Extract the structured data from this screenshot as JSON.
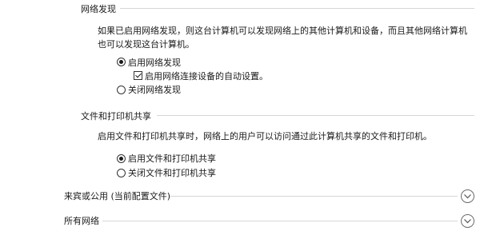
{
  "network_discovery": {
    "title": "网络发现",
    "description": "如果已启用网络发现，则这台计算机可以发现网络上的其他计算机和设备，而且其他网络计算机也可以发现这台计算机。",
    "options": {
      "enable": "启用网络发现",
      "auto_setup": "启用网络连接设备的自动设置。",
      "disable": "关闭网络发现"
    },
    "selected": "enable",
    "auto_setup_checked": true
  },
  "file_printer_sharing": {
    "title": "文件和打印机共享",
    "description": "启用文件和打印机共享时，网络上的用户可以访问通过此计算机共享的文件和打印机。",
    "options": {
      "enable": "启用文件和打印机共享",
      "disable": "关闭文件和打印机共享"
    },
    "selected": "enable"
  },
  "sections": {
    "guest_public": "来宾或公用 (当前配置文件)",
    "all_networks": "所有网络"
  }
}
